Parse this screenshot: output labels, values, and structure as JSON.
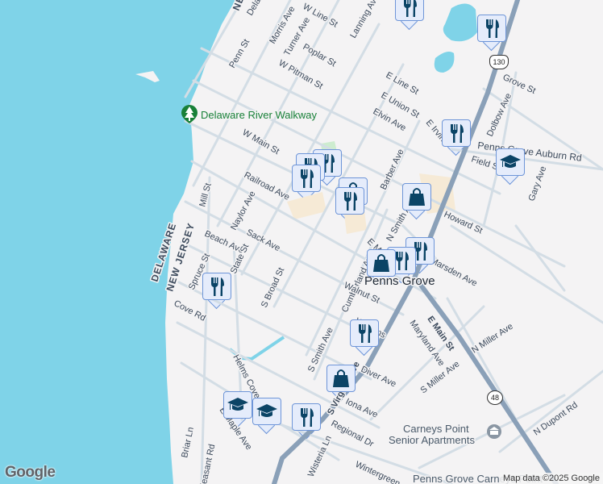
{
  "map": {
    "states": {
      "delaware": "DELAWARE",
      "new_jersey": "NEW JERSEY"
    },
    "town": "Penns Grove",
    "poi": {
      "walkway": "Delaware River Walkway",
      "senior_apartments_line1": "Carneys Point",
      "senior_apartments_line2": "Senior Apartments",
      "bottom_poi": "Penns Grove Carneys Point"
    },
    "route_shields": {
      "us130": "130",
      "nj48": "48"
    },
    "streets": {
      "delaware_ave": "Delaware Ave",
      "morris_ave": "Morris Ave",
      "w_line_st": "W Line St",
      "turner_ave": "Turner Ave",
      "poplar_st": "Poplar St",
      "penn_st": "Penn St",
      "lanning_ave": "Lanning Ave",
      "w_pitman_st": "W Pitman St",
      "e_line_st": "E Line St",
      "e_union_st": "E Union St",
      "elvin_ave": "Elvin Ave",
      "e_irvin": "E Irvin",
      "grove_st": "Grove St",
      "dolbow_ave": "Dolbow Ave",
      "auburn_rd": "Penns Grove Auburn Rd",
      "field_st": "Field St",
      "gary_ave": "Gary Ave",
      "w_main_st": "W Main St",
      "railroad_ave": "Railroad Ave",
      "mill_st": "Mill St",
      "naylor_ave": "Naylor Ave",
      "barber_ave": "Barber Ave",
      "howard_st": "Howard St",
      "beach_ave": "Beach Ave",
      "sack_ave": "Sack Ave",
      "e_main_st_north": "E Main St",
      "n_smith_ave": "N Smith Ave",
      "marsden_ave": "Marsden Ave",
      "state_st": "State St",
      "spruce_st": "Spruce St",
      "cove_rd": "Cove Rd",
      "s_broad_st": "S Broad St",
      "cumberland_ave": "Cumberland Ave",
      "walnut_st": "Walnut St",
      "e_main_st": "E Main St",
      "maryland_ave": "Maryland Ave",
      "n_miller_ave": "N Miller Ave",
      "s_smith_ave": "S Smith Ave",
      "williams": "Williams",
      "s_virginia_ave": "S Virginia Ave",
      "diver_ave": "Diver Ave",
      "iona_ave": "Iona Ave",
      "s_miller_ave": "S Miller Ave",
      "n_dupont_rd": "N Dupont Rd",
      "regional_dr": "Regional Dr",
      "wisteria_ln": "Wisteria Ln",
      "wintergreen": "Wintergreen",
      "helms_cove": "Helms Cove",
      "e_maple_ave": "E Maple Ave",
      "briar_ln": "Briar Ln",
      "pleasant_rd": "Pleasant Rd"
    }
  },
  "branding": {
    "logo": "Google",
    "attribution": "Map data ©2025 Google"
  },
  "colors": {
    "water": "#7fd3e8",
    "land": "#f4f3f4",
    "highway": "#8aa0b8",
    "marker_icon": "#0b4466",
    "marker_bg": "#e5ecfb"
  }
}
